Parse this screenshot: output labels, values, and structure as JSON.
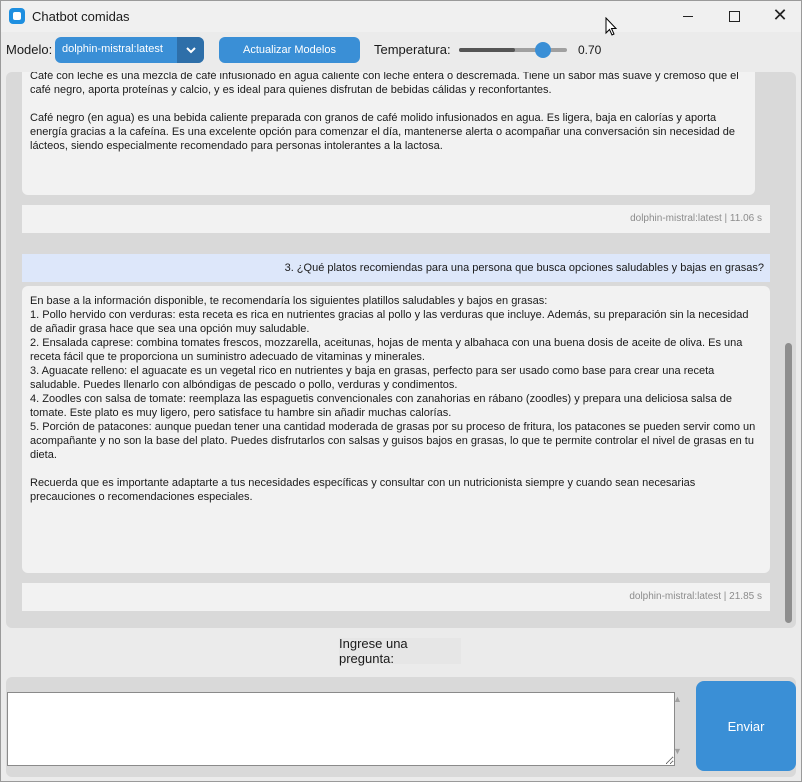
{
  "window": {
    "title": "Chatbot comidas"
  },
  "toolbar": {
    "model_label": "Modelo:",
    "model_selected": "dolphin-mistral:latest",
    "update_button": "Actualizar Modelos",
    "temperature_label": "Temperatura:",
    "temperature_value": "0.70",
    "temperature_fraction": 0.7
  },
  "chat": {
    "messages": [
      {
        "role": "assistant",
        "paragraphs": [
          "Café con leche es una mezcla de café infusionado en agua caliente con leche entera o descremada. Tiene un sabor más suave y cremoso que el café negro, aporta proteínas y calcio, y es ideal para quienes disfrutan de bebidas cálidas y reconfortantes.",
          "Café negro (en agua) es una bebida caliente preparada con granos de café molido infusionados en agua. Es ligera, baja en calorías y aporta energía gracias a la cafeína. Es una excelente opción para comenzar el día, mantenerse alerta o acompañar una conversación sin necesidad de lácteos, siendo especialmente recomendado para personas intolerantes a la lactosa."
        ],
        "meta": "dolphin-mistral:latest  |  11.06 s"
      },
      {
        "role": "user",
        "text": "3. ¿Qué platos recomiendas para una persona que busca opciones saludables y bajas en grasas?"
      },
      {
        "role": "assistant",
        "paragraphs": [
          "En base a la información disponible, te recomendaría los siguientes platillos saludables y bajos en grasas:\n1. Pollo hervido con verduras: esta receta es rica en nutrientes gracias al pollo y las verduras que incluye. Además, su preparación sin la necesidad de añadir grasa hace que sea una opción muy saludable.\n2. Ensalada caprese: combina tomates frescos, mozzarella, aceitunas, hojas de menta y albahaca con una buena dosis de aceite de oliva. Es una receta fácil que te proporciona un suministro adecuado de vitaminas y minerales.\n3. Aguacate relleno: el aguacate es un vegetal rico en nutrientes y baja en grasas, perfecto para ser usado como base para crear una receta saludable. Puedes llenarlo con albóndigas de pescado o pollo, verduras y condimentos.\n4. Zoodles con salsa de tomate: reemplaza las espaguetis convencionales con zanahorias en rábano (zoodles) y prepara una deliciosa salsa de tomate. Este plato es muy ligero, pero satisface tu hambre sin añadir muchas calorías.\n5. Porción de patacones: aunque puedan tener una cantidad moderada de grasas por su proceso de fritura, los patacones se pueden servir como un acompañante y no son la base del plato. Puedes disfrutarlos con salsas y guisos bajos en grasas, lo que te permite controlar el nivel de grasas en tu dieta.",
          "Recuerda que es importante adaptarte a tus necesidades específicas y consultar con un nutricionista siempre y cuando sean necesarias precauciones o recomendaciones especiales."
        ],
        "meta": "dolphin-mistral:latest  |  21.85 s"
      }
    ]
  },
  "input": {
    "label": "Ingrese una pregunta:",
    "value": "",
    "send_button": "Enviar"
  },
  "icons": {
    "app": "chat-app-icon",
    "minimize": "minimize-icon",
    "maximize": "maximize-icon",
    "close": "close-icon",
    "dropdown": "chevron-down-icon"
  },
  "colors": {
    "accent": "#3a8fd6",
    "accent_dark": "#2e6fa9",
    "user_bubble": "#dde7fa",
    "bot_bubble": "#f2f2f2",
    "panel": "#d9d9d9"
  }
}
